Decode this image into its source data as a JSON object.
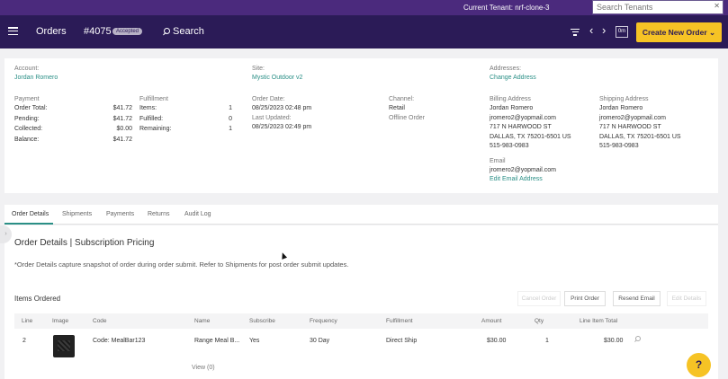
{
  "tenant": {
    "label": "Current Tenant: nrf-clone-3",
    "search_placeholder": "Search Tenants"
  },
  "header": {
    "title": "Orders",
    "order_number": "#4075",
    "status_badge": "Accepted",
    "search_label": "Search",
    "om_label": "0m",
    "new_order_label": "Create New Order ⌄"
  },
  "account": {
    "label": "Account:",
    "name": "Jordan Romero"
  },
  "site": {
    "label": "Site:",
    "name": "Mystic Outdoor v2"
  },
  "addresses": {
    "label": "Addresses:",
    "change_link": "Change Address"
  },
  "payment": {
    "label": "Payment",
    "rows": [
      {
        "label": "Order Total:",
        "value": "$41.72"
      },
      {
        "label": "Pending:",
        "value": "$41.72"
      },
      {
        "label": "Collected:",
        "value": "$0.00"
      },
      {
        "label": "Balance:",
        "value": "$41.72"
      }
    ]
  },
  "fulfillment": {
    "label": "Fulfillment",
    "rows": [
      {
        "label": "Items:",
        "value": "1"
      },
      {
        "label": "Fulfilled:",
        "value": "0"
      },
      {
        "label": "Remaining:",
        "value": "1"
      }
    ]
  },
  "dates": {
    "order_date_label": "Order Date:",
    "order_date": "08/25/2023 02:48 pm",
    "updated_label": "Last Updated:",
    "updated": "08/25/2023 02:49 pm"
  },
  "channel": {
    "label": "Channel:",
    "value": "Retail",
    "sub": "Offline Order"
  },
  "billing": {
    "label": "Billing Address",
    "lines": [
      "Jordan Romero",
      "jromero2@yopmail.com",
      "717 N HARWOOD ST",
      "DALLAS, TX 75201-6501 US",
      "515-983-0983"
    ]
  },
  "shipping": {
    "label": "Shipping Address",
    "lines": [
      "Jordan Romero",
      "jromero2@yopmail.com",
      "717 N HARWOOD ST",
      "DALLAS, TX 75201-6501 US",
      "515-983-0983"
    ]
  },
  "email": {
    "label": "Email",
    "value": "jromero2@yopmail.com",
    "edit_link": "Edit Email Address"
  },
  "tabs": [
    "Order Details",
    "Shipments",
    "Payments",
    "Returns",
    "Audit Log"
  ],
  "details": {
    "title": "Order Details | Subscription Pricing",
    "note": "*Order Details capture snapshot of order during order submit. Refer to Shipments for post order submit updates.",
    "items_title": "Items Ordered",
    "buttons": [
      "Cancel Order",
      "Print Order",
      "Resend Email",
      "Edit Details"
    ]
  },
  "table": {
    "headers": [
      "Line",
      "Image",
      "Code",
      "Name",
      "Subscribe",
      "Frequency",
      "Fulfillment",
      "Amount",
      "Qty",
      "Line Item Total"
    ],
    "row": {
      "line": "2",
      "code": "Code: MealBar123",
      "name": "Range Meal B...",
      "subscribe": "Yes",
      "frequency": "30 Day",
      "fulfillment": "Direct Ship",
      "amount": "$30.00",
      "qty": "1",
      "total": "$30.00"
    },
    "view_link": "View (0)"
  },
  "help_label": "?"
}
